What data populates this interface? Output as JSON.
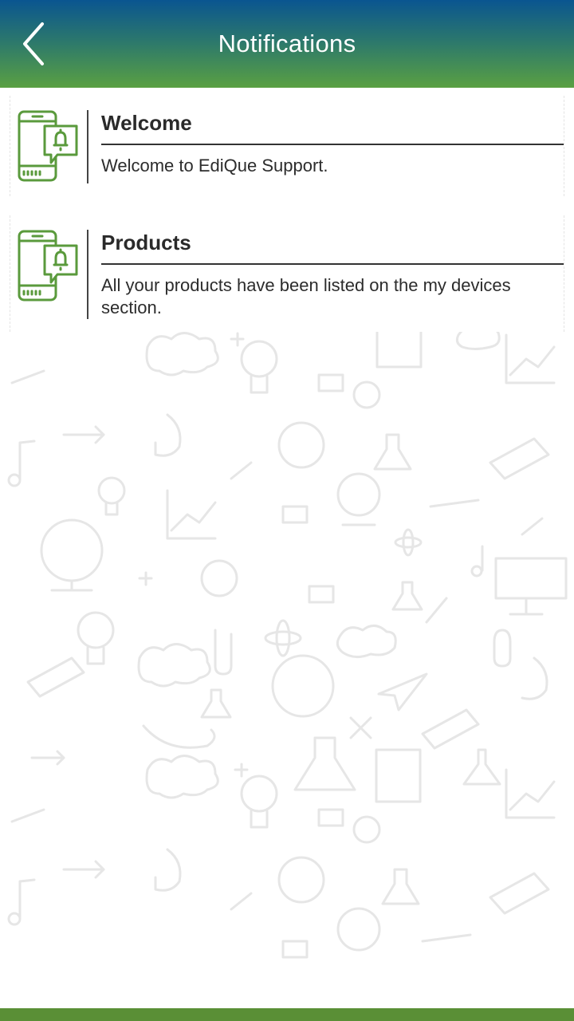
{
  "header": {
    "title": "Notifications",
    "back_icon": "back-arrow-icon"
  },
  "notifications": [
    {
      "title": "Welcome",
      "message": "Welcome to EdiQue Support.",
      "icon": "phone-bell-icon"
    },
    {
      "title": "Products",
      "message": "All your products have been listed on the my devices section.",
      "icon": "phone-bell-icon"
    }
  ],
  "colors": {
    "header_top": "#0a5590",
    "header_bottom": "#5aa042",
    "icon_green": "#5a9a3c",
    "bottom_bar": "#5a8f36"
  }
}
